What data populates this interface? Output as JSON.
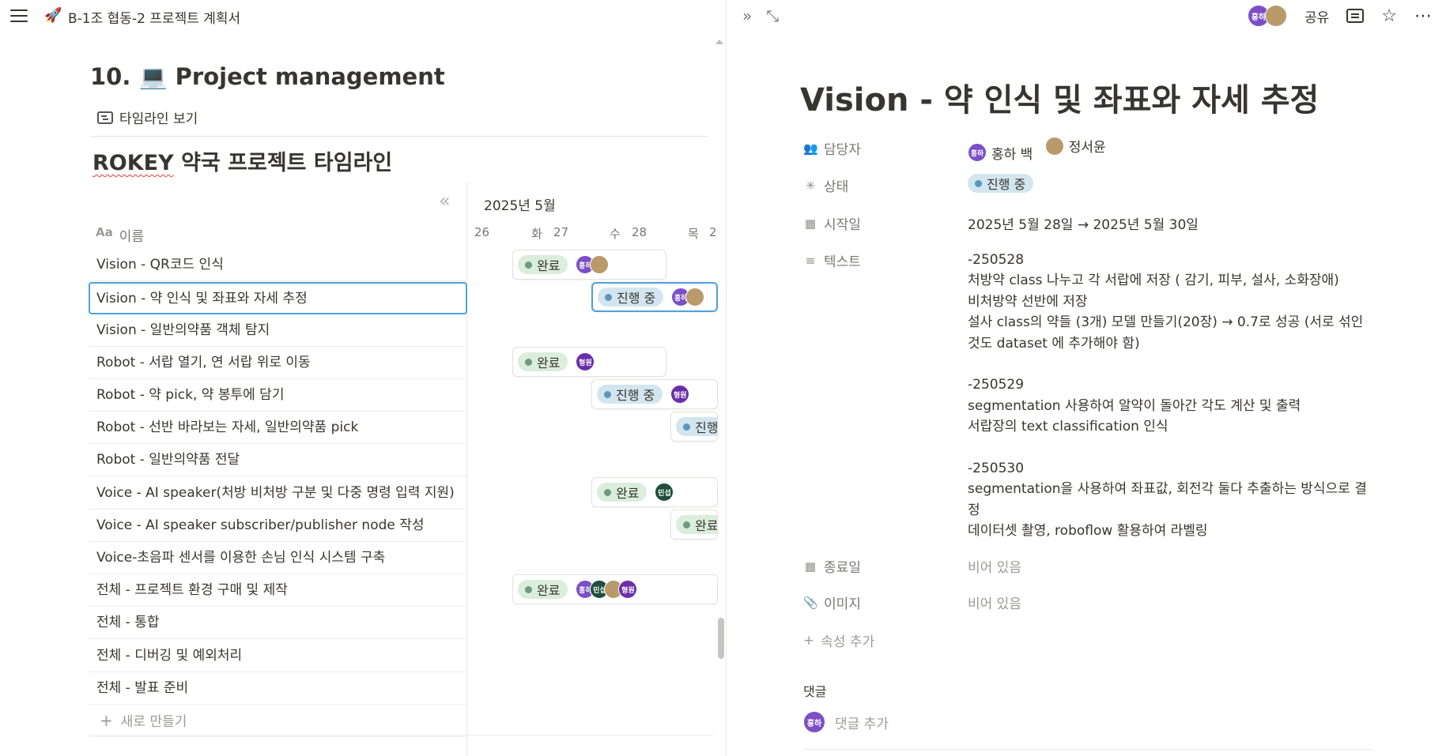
{
  "topbar": {
    "emoji": "🚀",
    "doc_title": "B-1조 협동-2 프로젝트 계획서"
  },
  "section": {
    "heading": "10. 💻 Project management",
    "view_label": "타임라인 보기"
  },
  "database": {
    "title_prefix": "ROKEY",
    "title_rest": " 약국 프로젝트 타임라인",
    "collapse_icon": "«",
    "month": "2025년 5월",
    "name_header_prefix": "Aa",
    "name_header": "이름",
    "days": {
      "d26": "26",
      "tue": "화",
      "d27": "27",
      "wed": "수",
      "d28": "28",
      "thu": "목",
      "d29": "2"
    },
    "rows": [
      "Vision - QR코드 인식",
      "Vision - 약 인식 및 좌표와 자세 추정",
      "Vision - 일반의약품 객체 탐지",
      "Robot - 서랍 열기, 연 서랍 위로 이동",
      "Robot - 약 pick, 약 봉투에 담기",
      "Robot - 선반 바라보는 자세, 일반의약품 pick",
      "Robot - 일반의약품 전달",
      "Voice - AI speaker(처방 비처방 구분 및 다중 명령 입력 지원)",
      "Voice - AI speaker subscriber/publisher node 작성",
      "Voice-초음파 센서를 이용한 손님 인식 시스템 구축",
      "전체 - 프로젝트 환경 구매 및 제작",
      "전체 - 통합",
      "전체 - 디버깅 및 예외처리",
      "전체 - 발표 준비"
    ],
    "new_label": "새로 만들기",
    "status_done": "완료",
    "status_progress": "진행 중",
    "status_progress_cut": "진행",
    "status_done_cut": "완료",
    "avatars": {
      "honghwa": "홍하",
      "minseop": "민섭",
      "hyungwon": "형원"
    }
  },
  "peek": {
    "expand_icon": "»",
    "fullscreen_icon": "⤡",
    "share": "공유",
    "title": "Vision - 약 인식 및 좌표와 자세 추정",
    "props": {
      "assignee_label": "담당자",
      "assignee_1": "홍하 백",
      "assignee_2": "정서윤",
      "status_label": "상태",
      "status_value": "진행 중",
      "start_label": "시작일",
      "start_value": "2025년 5월 28일 → 2025년 5월 30일",
      "text_label": "텍스트",
      "text_value": "-250528\n처방약 class 나누고 각 서랍에 저장 ( 감기, 피부, 설사, 소화장애)\n비처방약 선반에 저장\n설사 class의 약들 (3개) 모델 만들기(20장) → 0.7로 성공 (서로 섞인 것도 dataset 에 추가해야 함)\n\n-250529\nsegmentation 사용하여 알약이 돌아간 각도 계산 및 출력\n서랍장의 text classification 인식\n\n-250530\nsegmentation을 사용하여 좌표값, 회전각 둘다 추출하는 방식으로 결정\n데이터셋 촬영, roboflow 활용하여 라벨링",
      "end_label": "종료일",
      "end_value": "비어 있음",
      "image_label": "이미지",
      "image_value": "비어 있음",
      "add_prop": "속성 추가"
    },
    "comments_label": "댓글",
    "comment_placeholder": "댓글 추가",
    "comment_avatar": "홍하"
  },
  "colors": {
    "accent_blue": "#4ea1dd",
    "done_bg": "#dbeddb",
    "progress_bg": "#d3e5ef"
  },
  "icons": [
    "menu-icon",
    "rocket-icon",
    "timeline-icon",
    "collapse-icon",
    "expand-icon",
    "fullscreen-icon",
    "comment-icon",
    "star-icon",
    "more-icon",
    "people-icon",
    "status-icon",
    "calendar-icon",
    "text-icon",
    "paperclip-icon",
    "plus-icon"
  ]
}
